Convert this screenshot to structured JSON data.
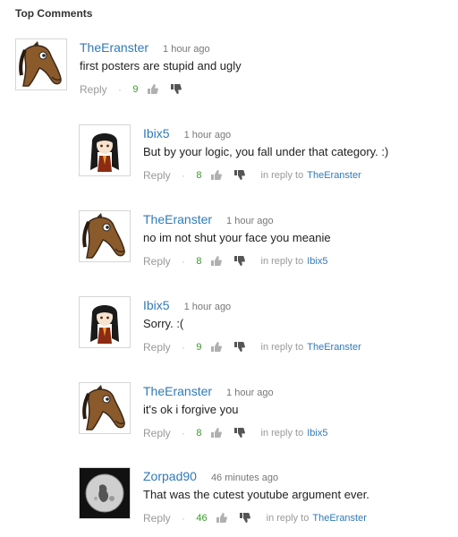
{
  "section": {
    "title": "Top Comments"
  },
  "labels": {
    "reply": "Reply",
    "separator": "·",
    "in_reply_to": "in reply to"
  },
  "colors": {
    "author": "#2f7ab8",
    "likes": "#3a9a28",
    "muted": "#999999"
  },
  "comments": [
    {
      "author": "TheEranster",
      "time": "1 hour ago",
      "text": "first posters are stupid and ugly",
      "likes": "9",
      "in_reply_to": "",
      "avatar": "horse-avatar"
    },
    {
      "author": "Ibix5",
      "time": "1 hour ago",
      "text": "But by your logic, you fall under that category. :)",
      "likes": "8",
      "in_reply_to": "TheEranster",
      "avatar": "anime-girl-avatar"
    },
    {
      "author": "TheEranster",
      "time": "1 hour ago",
      "text": "no im not shut your face you meanie",
      "likes": "8",
      "in_reply_to": "Ibix5",
      "avatar": "horse-avatar"
    },
    {
      "author": "Ibix5",
      "time": "1 hour ago",
      "text": "Sorry. :(",
      "likes": "9",
      "in_reply_to": "TheEranster",
      "avatar": "anime-girl-avatar"
    },
    {
      "author": "TheEranster",
      "time": "1 hour ago",
      "text": "it's ok i forgive you",
      "likes": "8",
      "in_reply_to": "Ibix5",
      "avatar": "horse-avatar"
    },
    {
      "author": "Zorpad90",
      "time": "46 minutes ago",
      "text": "That was the cutest youtube argument ever.",
      "likes": "46",
      "in_reply_to": "TheEranster",
      "avatar": "moon-avatar"
    }
  ]
}
